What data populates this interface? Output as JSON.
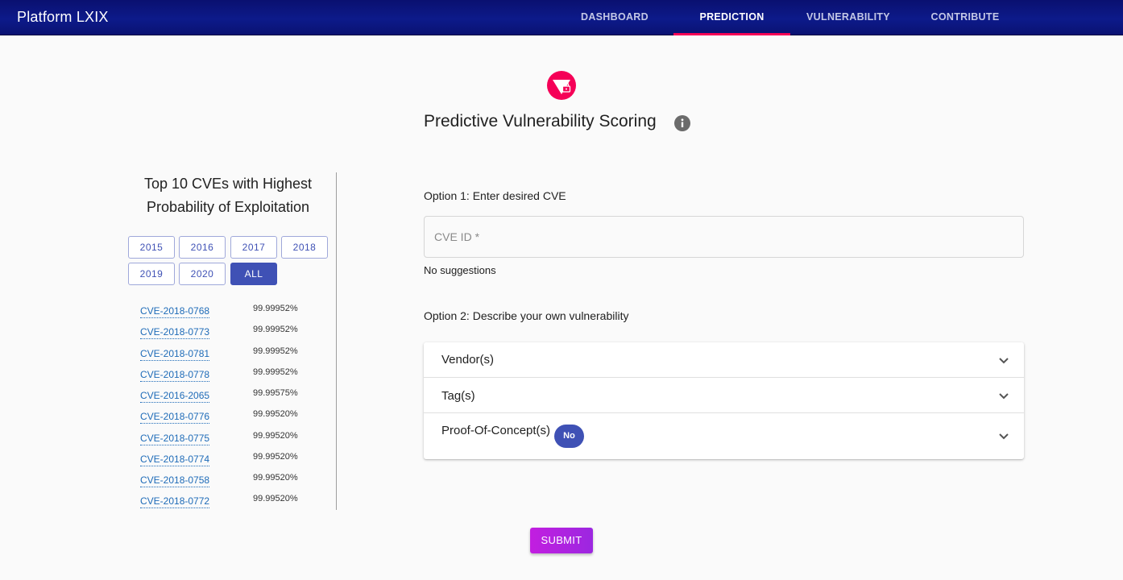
{
  "app": {
    "brand": "Platform LXIX",
    "nav": [
      {
        "label": "DASHBOARD",
        "active": false
      },
      {
        "label": "PREDICTION",
        "active": true
      },
      {
        "label": "VULNERABILITY",
        "active": false
      },
      {
        "label": "CONTRIBUTE",
        "active": false
      }
    ],
    "accent_color": "#f50057",
    "primary_color": "#3f51b5"
  },
  "header": {
    "logo_icon": "shield-lock-icon",
    "title": "Predictive Vulnerability Scoring",
    "info_icon": "info-icon"
  },
  "left_panel": {
    "title_line1": "Top 10 CVEs with Highest",
    "title_line2": "Probability of Exploitation",
    "years": [
      "2015",
      "2016",
      "2017",
      "2018",
      "2019",
      "2020",
      "ALL"
    ],
    "selected_year": "ALL",
    "cves": [
      {
        "id": "CVE-2018-0768",
        "prob": "99.99952%"
      },
      {
        "id": "CVE-2018-0773",
        "prob": "99.99952%"
      },
      {
        "id": "CVE-2018-0781",
        "prob": "99.99952%"
      },
      {
        "id": "CVE-2018-0778",
        "prob": "99.99952%"
      },
      {
        "id": "CVE-2016-2065",
        "prob": "99.99575%"
      },
      {
        "id": "CVE-2018-0776",
        "prob": "99.99520%"
      },
      {
        "id": "CVE-2018-0775",
        "prob": "99.99520%"
      },
      {
        "id": "CVE-2018-0774",
        "prob": "99.99520%"
      },
      {
        "id": "CVE-2018-0758",
        "prob": "99.99520%"
      },
      {
        "id": "CVE-2018-0772",
        "prob": "99.99520%"
      }
    ]
  },
  "form": {
    "option1_label": "Option 1: Enter desired CVE",
    "cve_input_label": "CVE ID *",
    "cve_input_value": "",
    "no_suggestions": "No suggestions",
    "option2_label": "Option 2: Describe your own vulnerability",
    "accordion": [
      {
        "label": "Vendor(s)"
      },
      {
        "label": "Tag(s)"
      },
      {
        "label": "Proof-Of-Concept(s)",
        "chip": "No"
      }
    ],
    "submit_label": "SUBMIT"
  }
}
